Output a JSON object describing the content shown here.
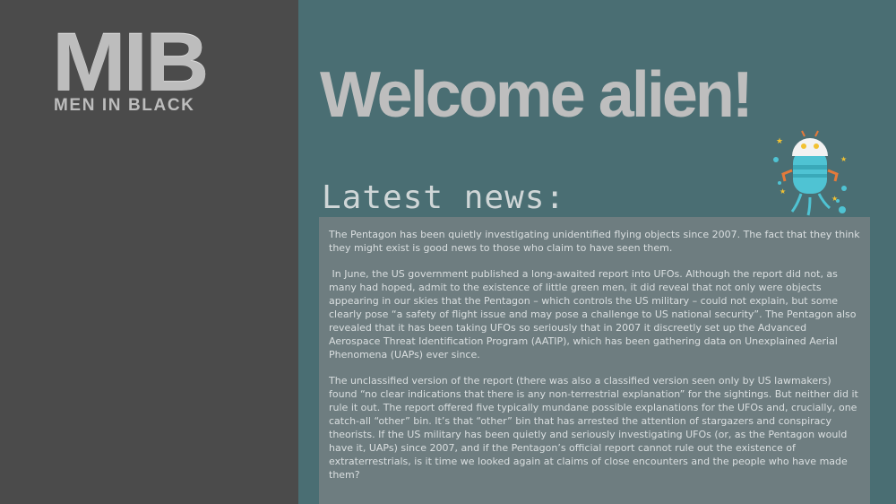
{
  "logo": {
    "title": "MIB",
    "subtitle": "MEN IN BLACK"
  },
  "main": {
    "heading": "Welcome alien!",
    "news_title": "Latest news:",
    "robot_icon": "alien-robot-icon",
    "paragraphs": [
      "The Pentagon has been quietly investigating unidentified flying objects since 2007. The fact that they think they might exist is good news to those who claim to have seen them.",
      " In June, the US government published a long-awaited report into UFOs. Although the report did not, as many had hoped, admit to the existence of little green men, it did reveal that not only were objects appearing in our skies that the Pentagon – which controls the US military – could not explain, but some clearly pose “a safety of flight issue and may pose a challenge to US national security”. The Pentagon also revealed that it has been taking UFOs so seriously that in 2007 it discreetly set up the Advanced Aerospace Threat Identification Program (AATIP), which has been gathering data on Unexplained Aerial Phenomena (UAPs) ever since.",
      "The unclassified version of the report (there was also a classified version seen only by US lawmakers) found “no clear indications that there is any non-terrestrial explanation” for the sightings. But neither did it rule it out. The report offered five typically mundane possible explanations for the UFOs and, crucially, one catch-all “other” bin. It’s that “other” bin that has arrested the attention of stargazers and conspiracy theorists. If the US military has been quietly and seriously investigating UFOs (or, as the Pentagon would have it, UAPs) since 2007, and if the Pentagon’s official report cannot rule out the existence of extraterrestrials, is it time we looked again at claims of close encounters and the people who have made them?"
    ]
  },
  "colors": {
    "sidebar": "#4b4b4b",
    "main_bg": "#4a6e73",
    "news_box": "#6e7d80",
    "heading_text": "#bebebe",
    "robot_body": "#4fc3d3"
  }
}
